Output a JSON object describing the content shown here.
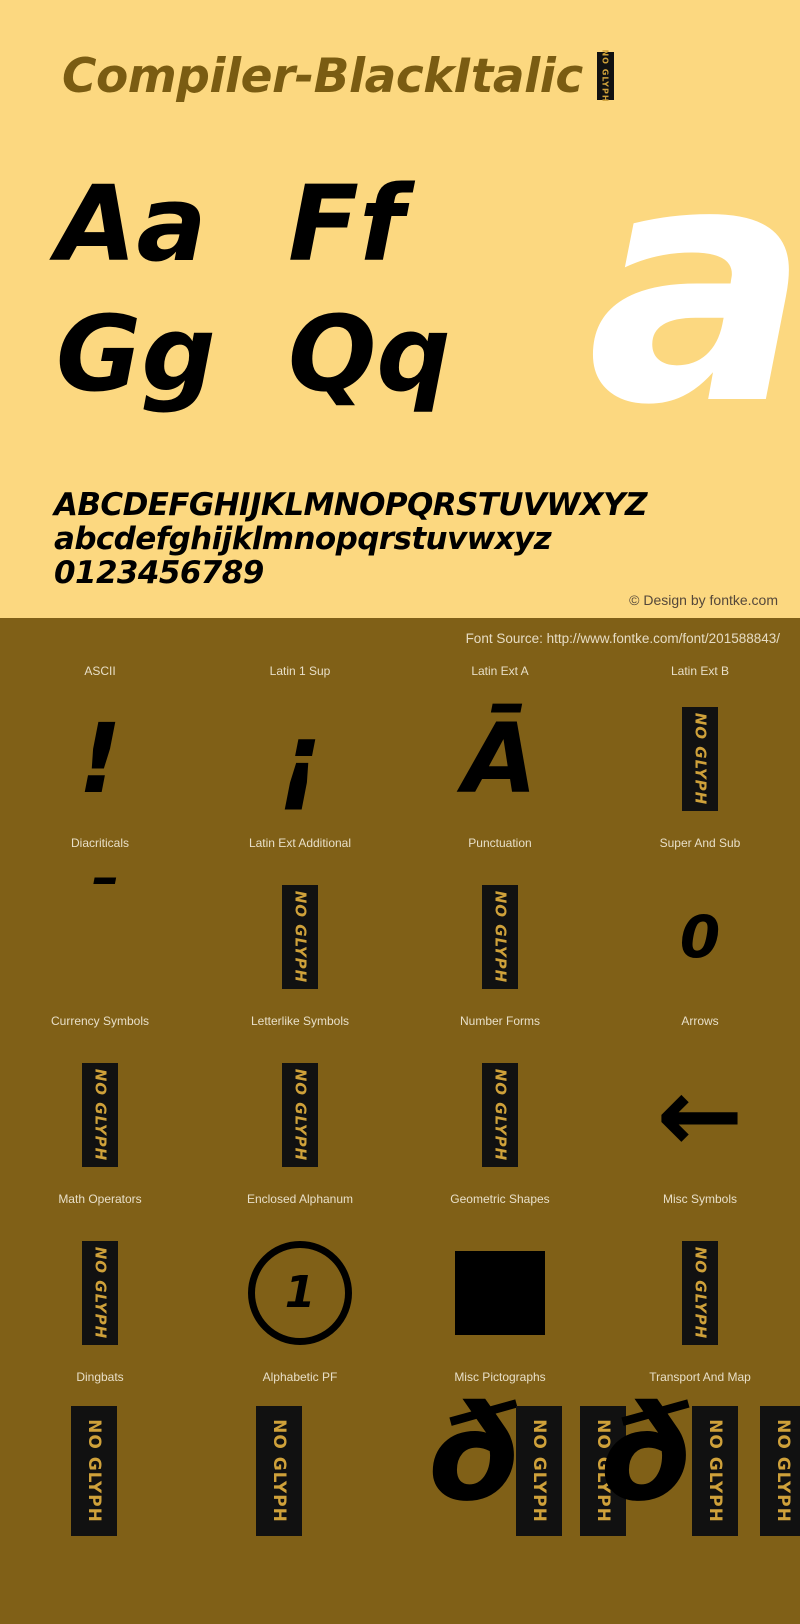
{
  "colors": {
    "top_background": "#fcd880",
    "bottom_background": "#806017",
    "title_text": "#7a5c12",
    "glyph_black": "#000000",
    "big_letter_white": "#ffffff",
    "label_text": "#e8dfc8"
  },
  "header": {
    "title": "Compiler-BlackItalic",
    "badge_label": "NO GLYPH"
  },
  "specimen": {
    "big_letter": "a",
    "pairs": [
      {
        "label": "Aa"
      },
      {
        "label": "Ff"
      },
      {
        "label": "Gg"
      },
      {
        "label": "Qq"
      }
    ],
    "alphabet_lines": [
      "ABCDEFGHIJKLMNOPQRSTUVWXYZ",
      "abcdefghijklmnopqrstuvwxyz",
      "0123456789"
    ],
    "design_credit": "© Design by fontke.com"
  },
  "source": {
    "font_source": "Font Source: http://www.fontke.com/font/201588843/"
  },
  "blocks": {
    "row1_labels": [
      "ASCII",
      "Latin 1 Sup",
      "Latin Ext A",
      "Latin Ext B"
    ],
    "row1_glyphs": [
      "!",
      "¡",
      "Ā",
      "NO GLYPH"
    ],
    "row2_labels": [
      "Diacriticals",
      "Latin Ext Additional",
      "Punctuation",
      "Super And Sub"
    ],
    "row2_glyphs": [
      "ˉ",
      "NO GLYPH",
      "NO GLYPH",
      "0"
    ],
    "row3_labels": [
      "Currency Symbols",
      "Letterlike Symbols",
      "Number Forms",
      "Arrows"
    ],
    "row3_glyphs": [
      "NO GLYPH",
      "NO GLYPH",
      "NO GLYPH",
      "←"
    ],
    "row4_labels": [
      "Math Operators",
      "Enclosed Alphanum",
      "Geometric Shapes",
      "Misc Symbols"
    ],
    "row4_glyphs": [
      "NO GLYPH",
      "①",
      "■",
      "NO GLYPH"
    ],
    "row5_labels": [
      "Dingbats",
      "Alphabetic PF",
      "Misc Pictographs",
      "Transport And Map"
    ],
    "row5_glyphs": [
      "NO GLYPH",
      "NO GLYPH",
      "ð",
      "NO GLYPH"
    ],
    "noglyph_label": "NO GLYPH",
    "enclosed_one": "1",
    "pictograph_glyph": "ð",
    "superscript_zero": "0",
    "arrow_glyph": "←"
  }
}
